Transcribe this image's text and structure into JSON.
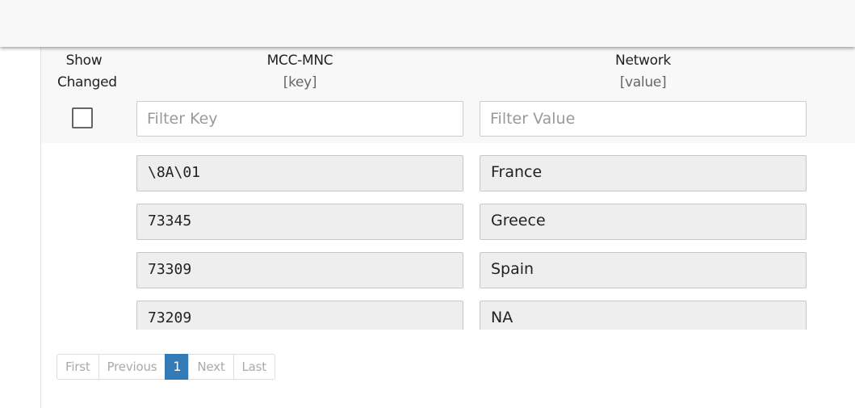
{
  "table": {
    "columns": {
      "show_changed": {
        "line1": "Show",
        "line2": "Changed"
      },
      "key": {
        "title": "MCC-MNC",
        "subtitle": "[key]"
      },
      "value": {
        "title": "Network",
        "subtitle": "[value]"
      }
    },
    "filters": {
      "key_placeholder": "Filter Key",
      "value_placeholder": "Filter Value",
      "show_changed_checked": false
    },
    "rows": [
      {
        "key": "\\8A\\01",
        "value": "France"
      },
      {
        "key": "73345",
        "value": "Greece"
      },
      {
        "key": "73309",
        "value": "Spain"
      },
      {
        "key": "73209",
        "value": "NA"
      }
    ]
  },
  "pagination": {
    "first": "First",
    "previous": "Previous",
    "current": "1",
    "next": "Next",
    "last": "Last"
  }
}
